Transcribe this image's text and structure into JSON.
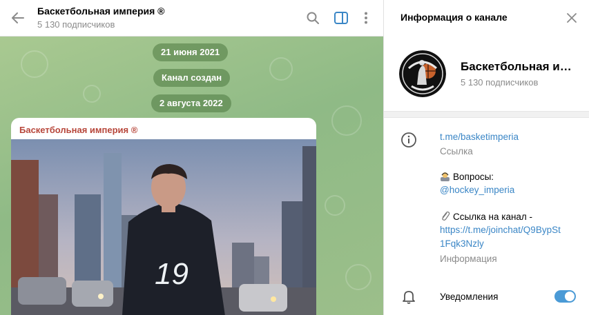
{
  "chat": {
    "title": "Баскетбольная империя ®",
    "subscribers": "5 130 подписчиков",
    "dates": [
      "21 июня 2021",
      "Канал создан",
      "2 августа 2022"
    ],
    "message": {
      "author": "Баскетбольная империя ®",
      "photo_jersey_number": "19"
    }
  },
  "info_panel": {
    "title": "Информация о канале",
    "channel_name": "Баскетбольная империя ®",
    "subscribers": "5 130 подписчиков",
    "link": "t.me/basketimperia",
    "link_caption": "Ссылка",
    "questions_label": "Вопросы:",
    "questions_contact": "@hockey_imperia",
    "invite_label": "Ссылка на канал -",
    "invite_link_line1": "https://t.me/joinchat/Q9BypSt",
    "invite_link_line2": "1Fqk3Nzly",
    "info_caption": "Информация",
    "notifications_label": "Уведомления",
    "notifications_on": true
  },
  "icons": {
    "back": "arrow-left-icon",
    "search": "search-icon",
    "sidebar": "sidebar-toggle-icon",
    "more": "more-vertical-icon",
    "close": "close-icon",
    "info": "info-icon",
    "bell": "bell-icon"
  },
  "colors": {
    "accent": "#3a86c6",
    "author": "#b7463a",
    "toggle": "#4a9ad6",
    "chat_bg": "#9cbf8a"
  }
}
